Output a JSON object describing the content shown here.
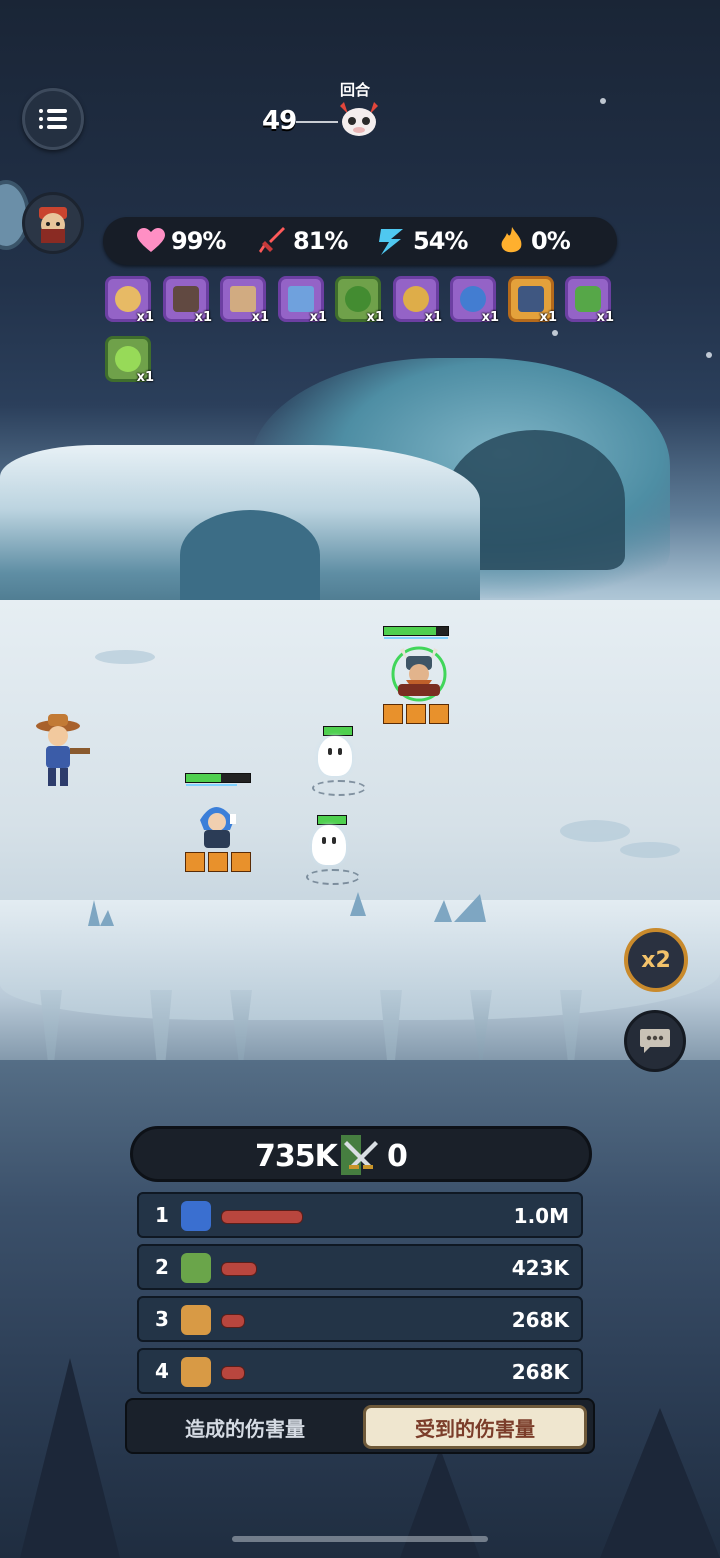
{
  "hud": {
    "round_label": "回合",
    "round_number": "49",
    "stats": [
      {
        "name": "health",
        "icon": "heart-icon",
        "value": "99%",
        "color": "#ff8fc4"
      },
      {
        "name": "attack",
        "icon": "sword-icon",
        "value": "81%",
        "color": "#ff5a5a"
      },
      {
        "name": "speed",
        "icon": "lightning-icon",
        "value": "54%",
        "color": "#4fc8f0"
      },
      {
        "name": "fire",
        "icon": "flame-icon",
        "value": "0%",
        "color": "#ffb02e"
      }
    ]
  },
  "items": [
    {
      "icon": "orb-wand-icon",
      "qty": "x1"
    },
    {
      "icon": "chest-icon",
      "qty": "x1"
    },
    {
      "icon": "crate-icon",
      "qty": "x1"
    },
    {
      "icon": "scroll-icon",
      "qty": "x1"
    },
    {
      "icon": "serpent-icon",
      "qty": "x1"
    },
    {
      "icon": "trophy-icon",
      "qty": "x1"
    },
    {
      "icon": "vortex-icon",
      "qty": "x1"
    },
    {
      "icon": "axe-icon",
      "qty": "x1"
    },
    {
      "icon": "potion-icon",
      "qty": "x1"
    },
    {
      "icon": "green-staff-icon",
      "qty": "x1"
    }
  ],
  "buttons": {
    "speed_label": "x2"
  },
  "damage": {
    "total_left": "735K",
    "total_right": "0",
    "rows": [
      {
        "rank": "1",
        "amount": "1.0M",
        "bar_fraction": 1.0
      },
      {
        "rank": "2",
        "amount": "423K",
        "bar_fraction": 0.42
      },
      {
        "rank": "3",
        "amount": "268K",
        "bar_fraction": 0.27
      },
      {
        "rank": "4",
        "amount": "268K",
        "bar_fraction": 0.27
      }
    ],
    "tabs": {
      "dealt": "造成的伤害量",
      "taken": "受到的伤害量"
    }
  },
  "colors": {
    "hp_green": "#4fd04f",
    "damage_bar": "#b9463e",
    "active_tab_bg": "#efe6cf"
  }
}
